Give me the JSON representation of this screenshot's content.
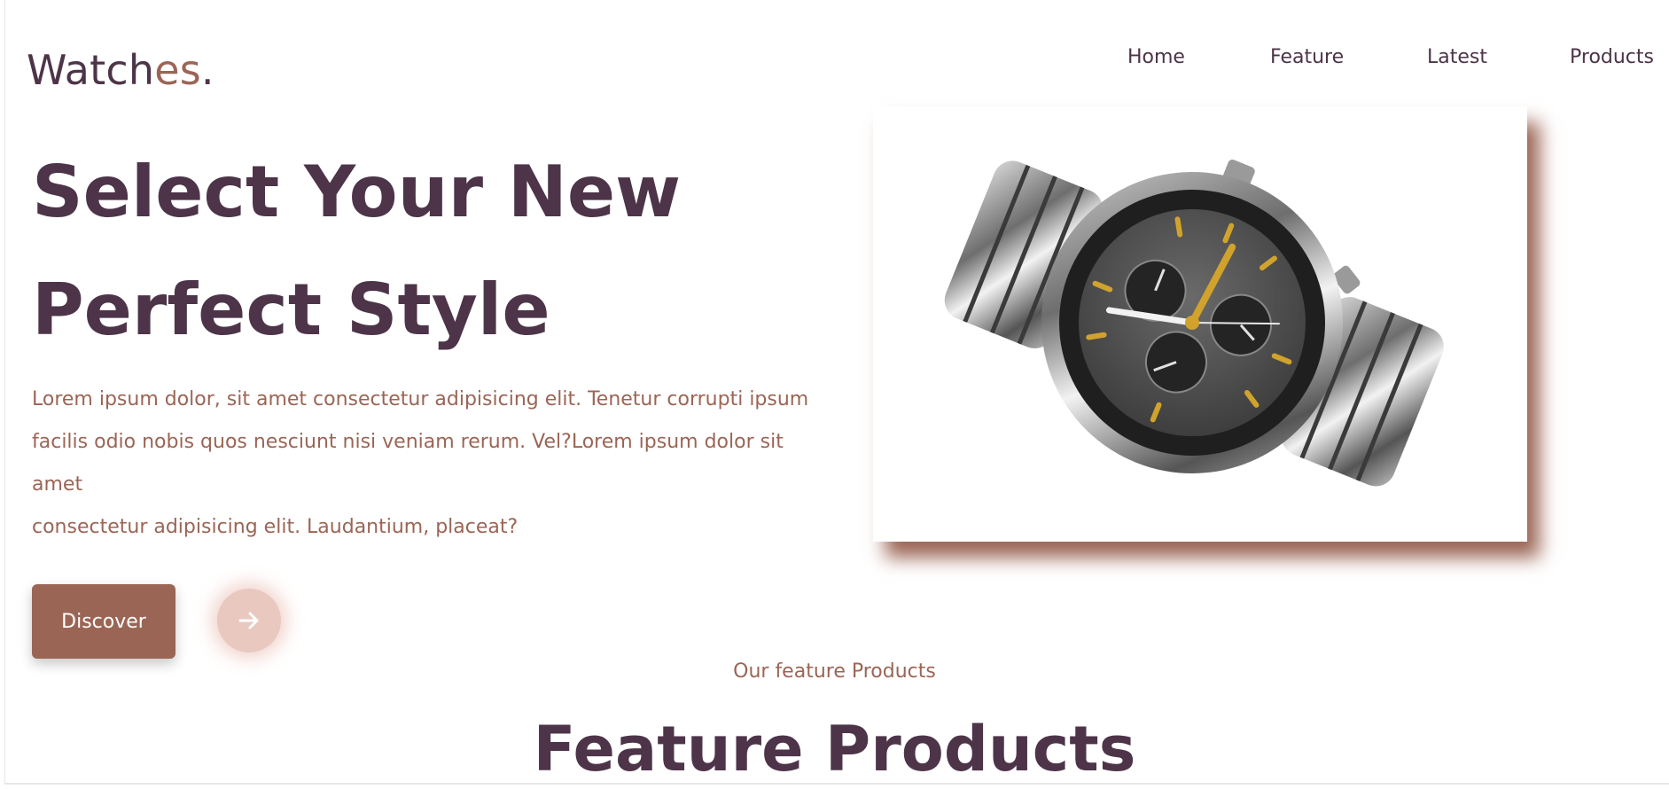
{
  "header": {
    "logo_main": "Watch",
    "logo_accent": "es",
    "logo_dot": ".",
    "nav": [
      {
        "label": "Home"
      },
      {
        "label": "Feature"
      },
      {
        "label": "Latest"
      },
      {
        "label": "Products"
      }
    ]
  },
  "hero": {
    "title_line1": "Select Your New",
    "title_line2": "Perfect Style",
    "description_line1": "Lorem ipsum dolor, sit amet consectetur adipisicing elit. Tenetur corrupti ipsum",
    "description_line2": "facilis odio nobis quos nesciunt nisi veniam rerum. Vel?Lorem ipsum dolor sit amet",
    "description_line3": "consectetur adipisicing elit. Laudantium, placeat?",
    "discover_label": "Discover",
    "arrow_icon": "arrow-right-icon",
    "image_icon": "wristwatch-image"
  },
  "features": {
    "subtitle": "Our feature Products",
    "title": "Feature Products"
  },
  "colors": {
    "primary": "#4d3449",
    "accent": "#9b6555",
    "accent_light": "#e9c8bf"
  }
}
